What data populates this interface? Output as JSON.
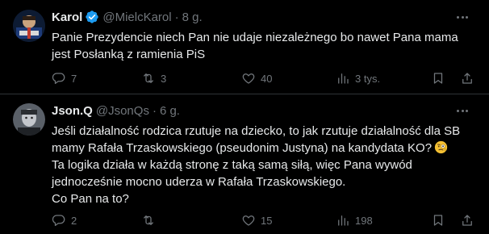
{
  "tweets": [
    {
      "name": "Karol",
      "handle": "@MielcKarol",
      "separator": "·",
      "time": "8 g.",
      "lines": [
        "Panie Prezydencie niech Pan nie udaje niezależnego bo nawet Pana mama",
        "jest Posłanką z ramienia PiS"
      ],
      "replies": "7",
      "reposts": "3",
      "likes": "40",
      "views": "3 tys."
    },
    {
      "name": "Json.Q",
      "handle": "@JsonQs",
      "separator": "·",
      "time": "6 g.",
      "lines": [
        "Jeśli działalność rodzica rzutuje na dziecko, to jak rzutuje działalność dla SB",
        "mamy Rafała Trzaskowskiego (pseudonim Justyna) na kandydata KO?",
        "Ta logika działa w każdą stronę z taką samą siłą, więc Pana wywód",
        "jednocześnie mocno uderza w Rafała Trzaskowskiego.",
        "Co Pan na to?"
      ],
      "replies": "2",
      "reposts": "",
      "likes": "15",
      "views": "198"
    }
  ],
  "icons": {
    "verified": "verified-badge-icon",
    "more": "more-horizontal-icon",
    "reply": "reply-icon",
    "repost": "repost-icon",
    "like": "heart-icon",
    "views": "views-chart-icon",
    "bookmark": "bookmark-icon",
    "share": "share-icon",
    "emoji": "face-with-monocle-emoji"
  },
  "colors": {
    "background": "#000000",
    "text": "#e7e9ea",
    "muted": "#71767b",
    "verified": "#1d9bf0",
    "divider": "#2f3336"
  }
}
